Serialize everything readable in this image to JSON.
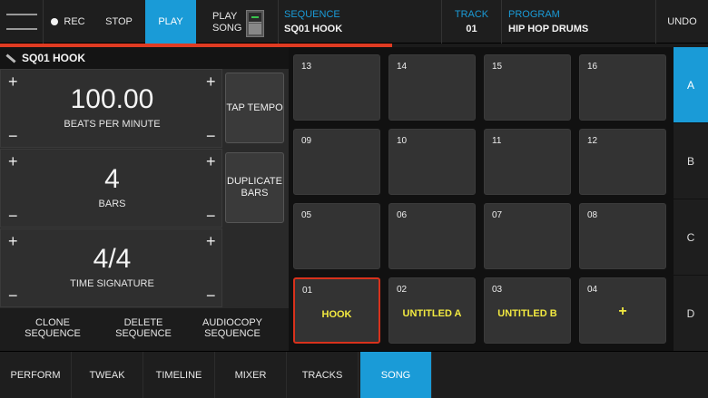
{
  "topbar": {
    "rec_label": "REC",
    "stop_label": "STOP",
    "play_label": "PLAY",
    "play_song_line1": "PLAY",
    "play_song_line2": "SONG",
    "sequence_caption": "SEQUENCE",
    "sequence_value": "SQ01 HOOK",
    "track_caption": "TRACK",
    "track_value": "01",
    "program_caption": "PROGRAM",
    "program_value": "HIP HOP DRUMS",
    "undo_label": "UNDO"
  },
  "panel": {
    "title": "SQ01 HOOK",
    "bpm": {
      "value": "100.00",
      "label": "BEATS PER MINUTE"
    },
    "bars": {
      "value": "4",
      "label": "BARS"
    },
    "timesig": {
      "value": "4/4",
      "label": "TIME SIGNATURE"
    },
    "plus": "+",
    "minus": "−",
    "tap_tempo": "TAP TEMPO",
    "duplicate_bars_1": "DUPLICATE",
    "duplicate_bars_2": "BARS",
    "actions": [
      {
        "l1": "CLONE",
        "l2": "SEQUENCE"
      },
      {
        "l1": "DELETE",
        "l2": "SEQUENCE"
      },
      {
        "l1": "AUDIOCOPY",
        "l2": "SEQUENCE"
      }
    ]
  },
  "pads": [
    {
      "num": "13",
      "name": ""
    },
    {
      "num": "14",
      "name": ""
    },
    {
      "num": "15",
      "name": ""
    },
    {
      "num": "16",
      "name": ""
    },
    {
      "num": "09",
      "name": ""
    },
    {
      "num": "10",
      "name": ""
    },
    {
      "num": "11",
      "name": ""
    },
    {
      "num": "12",
      "name": ""
    },
    {
      "num": "05",
      "name": ""
    },
    {
      "num": "06",
      "name": ""
    },
    {
      "num": "07",
      "name": ""
    },
    {
      "num": "08",
      "name": ""
    },
    {
      "num": "01",
      "name": "HOOK"
    },
    {
      "num": "02",
      "name": "UNTITLED A"
    },
    {
      "num": "03",
      "name": "UNTITLED B"
    },
    {
      "num": "04",
      "name": "+"
    }
  ],
  "banks": [
    "A",
    "B",
    "C",
    "D"
  ],
  "tabs": [
    "PERFORM",
    "TWEAK",
    "TIMELINE",
    "MIXER",
    "TRACKS",
    "SONG"
  ],
  "colors": {
    "accent": "#1a9bd7",
    "record_bar": "#e03b22",
    "pad_label": "#f2e940"
  }
}
